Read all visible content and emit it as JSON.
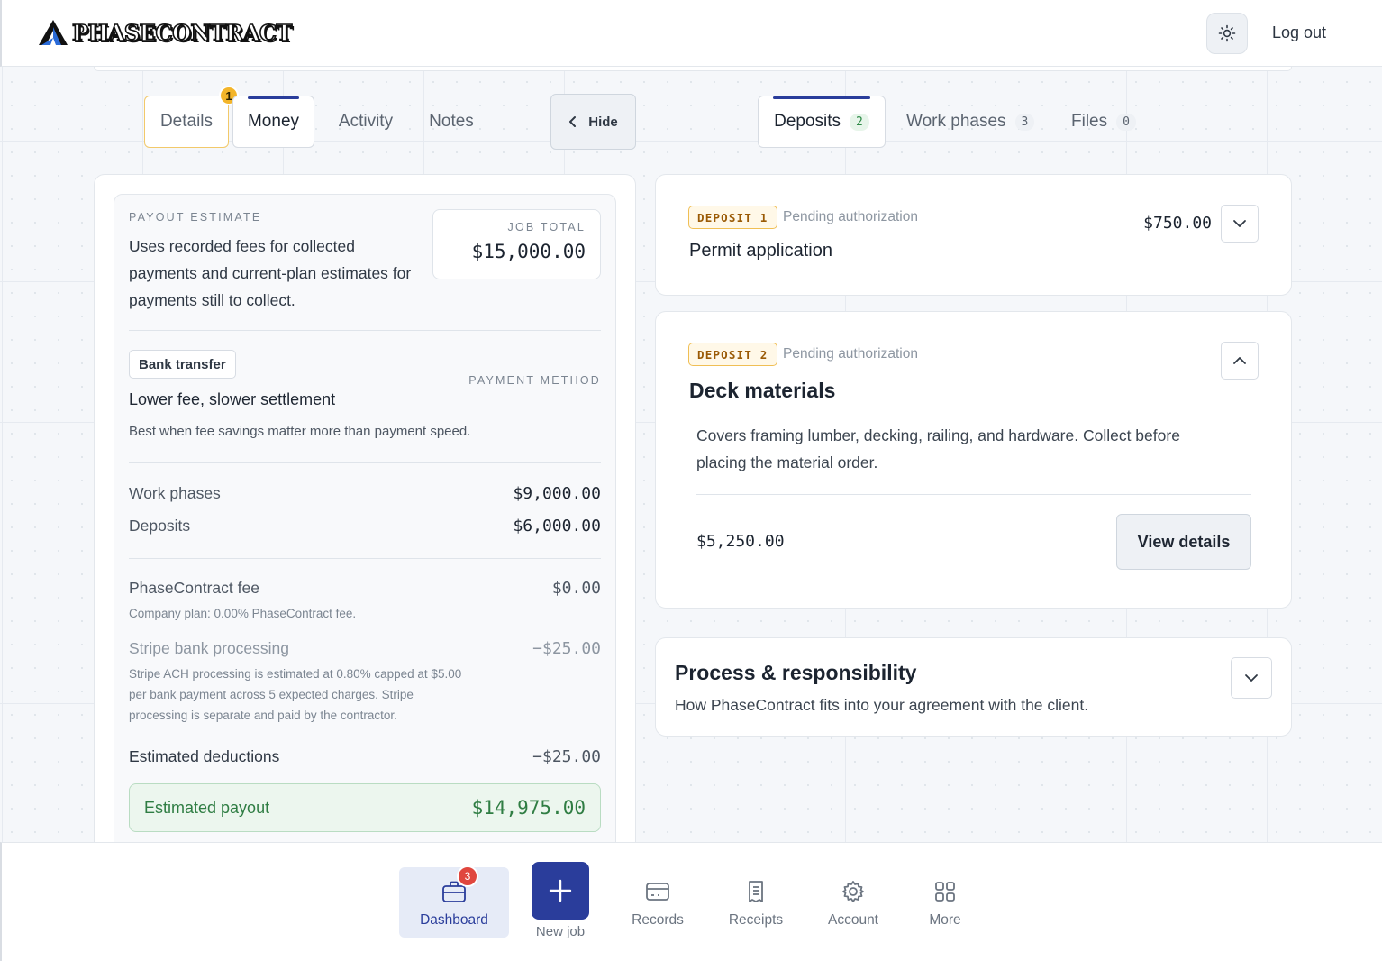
{
  "header": {
    "brand": "PHASECONTRACT",
    "theme_icon": "sun-icon",
    "logout_label": "Log out"
  },
  "left_tabs": {
    "details": "Details",
    "details_badge": "1",
    "money": "Money",
    "activity": "Activity",
    "notes": "Notes",
    "hide_label": "Hide"
  },
  "right_tabs": {
    "deposits": "Deposits",
    "deposits_count": "2",
    "work_phases": "Work phases",
    "work_phases_count": "3",
    "files": "Files",
    "files_count": "0"
  },
  "money": {
    "payout_eyebrow": "PAYOUT ESTIMATE",
    "payout_desc": "Uses recorded fees for collected payments and current-plan estimates for payments still to collect.",
    "job_total_label": "JOB TOTAL",
    "job_total_value": "$15,000.00",
    "method_badge": "Bank transfer",
    "method_eyebrow": "PAYMENT METHOD",
    "method_title": "Lower fee, slower settlement",
    "method_desc": "Best when fee savings matter more than payment speed.",
    "work_phases_label": "Work phases",
    "work_phases_value": "$9,000.00",
    "deposits_label": "Deposits",
    "deposits_value": "$6,000.00",
    "pc_fee_label": "PhaseContract fee",
    "pc_fee_value": "$0.00",
    "pc_fee_note": "Company plan: 0.00% PhaseContract fee.",
    "stripe_label": "Stripe bank processing",
    "stripe_value": "−$25.00",
    "stripe_note_1": "Stripe ACH processing is estimated at 0.80% capped at $5.00",
    "stripe_note_2": "per bank payment across 5 expected charges. Stripe",
    "stripe_note_3": "processing is separate and paid by the contractor.",
    "deductions_label": "Estimated deductions",
    "deductions_value": "−$25.00",
    "payout_label": "Estimated payout",
    "payout_value": "$14,975.00"
  },
  "deposits": [
    {
      "chip": "DEPOSIT 1",
      "status": "Pending authorization",
      "title": "Permit application",
      "amount": "$750.00"
    },
    {
      "chip": "DEPOSIT 2",
      "status": "Pending authorization",
      "title": "Deck materials",
      "desc_1": "Covers framing lumber, decking, railing, and hardware. Collect before",
      "desc_2": "placing the material order.",
      "amount": "$5,250.00",
      "button": "View details"
    }
  ],
  "process": {
    "title": "Process & responsibility",
    "desc": "How PhaseContract fits into your agreement with the client."
  },
  "bottom_nav": {
    "dashboard": "Dashboard",
    "dashboard_badge": "3",
    "new_job": "New job",
    "records": "Records",
    "receipts": "Receipts",
    "account": "Account",
    "more": "More"
  },
  "colors": {
    "brand_blue": "#2a3d9b",
    "deposit_chip": "#f0bf55",
    "payout_green": "#2f7d43",
    "badge_red": "#e0463e",
    "badge_yellow": "#f3b52a"
  }
}
